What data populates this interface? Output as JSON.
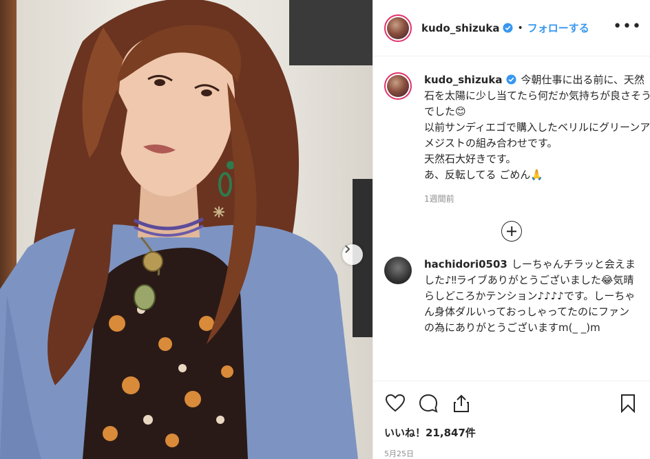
{
  "post": {
    "username": "kudo_shizuka",
    "follow_label": "フォローする",
    "separator": "•",
    "more_label": "•••",
    "caption_lines": [
      "今朝仕事に出る前に、天然石を太陽に少し当てたら何だか気持ちが良さそうでした😊",
      "以前サンディエゴで購入したベリルにグリーンアメジストの組み合わせです。",
      "天然石大好きです。",
      "あ、反転してる ごめん🙏"
    ],
    "caption_time": "1週間前",
    "likes_label": "いいね！21,847件",
    "date": "5月25日"
  },
  "comments": [
    {
      "username": "hachidori0503",
      "text": "しーちゃんチラッと会えました♪‼ライブありがとうございました😂気晴らしどころかテンション♪♪♪♪です。しーちゃん身体ダルいっておっしゃってたのにファンの為にありがとうございますm(_ _)m"
    }
  ],
  "icons": {
    "verified": "verified-badge-icon",
    "more": "more-options-icon",
    "next": "chevron-right-icon",
    "load_more": "plus-circle-icon",
    "like": "heart-icon",
    "comment": "comment-bubble-icon",
    "share": "share-icon",
    "save": "bookmark-icon"
  },
  "colors": {
    "accent": "#3897f0",
    "story_ring": "#e1306c",
    "text": "#262626",
    "muted": "#8e8e8e"
  }
}
